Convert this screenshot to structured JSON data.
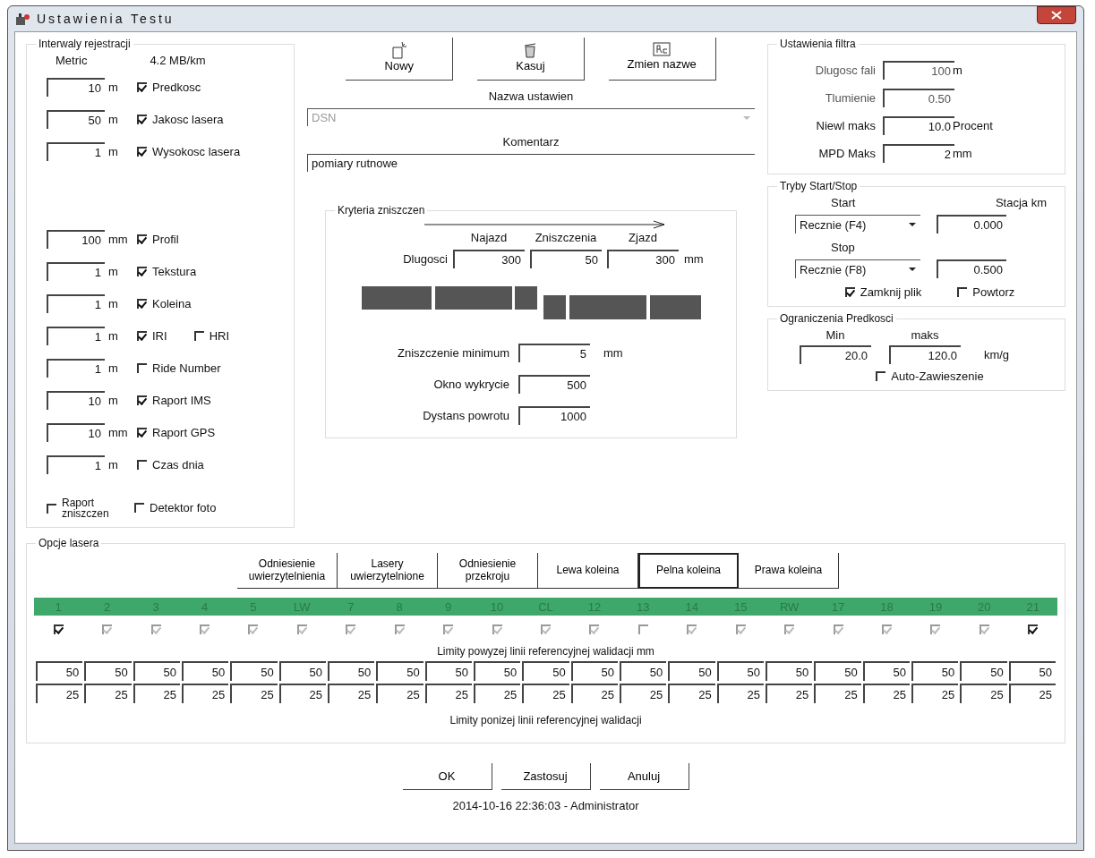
{
  "window": {
    "title": "Ustawienia Testu"
  },
  "intervals": {
    "title": "Interwaly rejestracji",
    "unit_header": "Metric",
    "rate": "4.2 MB/km",
    "groups": [
      {
        "rows": [
          {
            "kind": "field",
            "value": "10",
            "unit": "m",
            "label": "Predkosc",
            "checked": true
          },
          {
            "kind": "field",
            "value": "50",
            "unit": "m",
            "label": "Jakosc lasera",
            "checked": true
          },
          {
            "kind": "field",
            "value": "1",
            "unit": "m",
            "label": "Wysokosc lasera",
            "checked": true
          }
        ]
      },
      {
        "rows": [
          {
            "kind": "field",
            "value": "100",
            "unit": "mm",
            "label": "Profil",
            "checked": true
          },
          {
            "kind": "field",
            "value": "1",
            "unit": "m",
            "label": "Tekstura",
            "checked": true
          },
          {
            "kind": "field",
            "value": "1",
            "unit": "m",
            "label": "Koleina",
            "checked": true
          },
          {
            "kind": "field",
            "value": "1",
            "unit": "m",
            "label": "IRI",
            "checked": true,
            "extra": {
              "label": "HRI",
              "checked": false
            }
          },
          {
            "kind": "field",
            "value": "1",
            "unit": "m",
            "label": "Ride Number",
            "checked": false
          },
          {
            "kind": "field",
            "value": "10",
            "unit": "m",
            "label": "Raport IMS",
            "checked": true
          },
          {
            "kind": "field",
            "value": "10",
            "unit": "mm",
            "label": "Raport GPS",
            "checked": true
          },
          {
            "kind": "field",
            "value": "1",
            "unit": "m",
            "label": "Czas dnia",
            "checked": false
          },
          {
            "kind": "pair",
            "label": "Raport zniszczen",
            "checked": false,
            "extra": {
              "label": "Detektor foto",
              "checked": false
            }
          }
        ]
      }
    ]
  },
  "toolbar": [
    {
      "label": "Nowy",
      "kind": "new"
    },
    {
      "label": "Kasuj",
      "kind": "delete"
    },
    {
      "label": "Zmien nazwe",
      "kind": "rename"
    }
  ],
  "setting_name": {
    "label": "Nazwa ustawien",
    "value": "DSN"
  },
  "comment": {
    "label": "Komentarz",
    "value": "pomiary rutnowe"
  },
  "criteria": {
    "title": "Kryteria zniszczen",
    "headers": [
      "Najazd",
      "Zniszczenia",
      "Zjazd"
    ],
    "length_label": "Dlugosci",
    "lengths": [
      "300",
      "50",
      "300"
    ],
    "length_unit": "mm",
    "fields": [
      {
        "label": "Zniszczenie minimum",
        "value": "5",
        "unit": "mm"
      },
      {
        "label": "Okno wykrycie",
        "value": "500"
      },
      {
        "label": "Dystans powrotu",
        "value": "1000"
      }
    ]
  },
  "filter": {
    "title": "Ustawienia filtra",
    "fields": [
      {
        "label": "Dlugosc fali",
        "value": "100",
        "unit": "m",
        "disabled": true
      },
      {
        "label": "Tlumienie",
        "value": "0.50",
        "disabled": true
      },
      {
        "label": "Niewl maks",
        "value": "10.0",
        "unit": "Procent",
        "disabled": false
      },
      {
        "label": "MPD Maks",
        "value": "2",
        "unit": "mm",
        "disabled": false
      }
    ]
  },
  "start_stop": {
    "title": "Tryby Start/Stop",
    "station_label": "Stacja  km",
    "modes": [
      {
        "label": "Start",
        "value": "Recznie (F4)",
        "station": "0.000"
      },
      {
        "label": "Stop",
        "value": "Recznie (F8)",
        "station": "0.500"
      }
    ],
    "options": [
      {
        "label": "Zamknij plik",
        "checked": true
      },
      {
        "label": "Powtorz",
        "checked": false
      }
    ]
  },
  "speed": {
    "title": "Ograniczenia Predkosci",
    "min_label": "Min",
    "max_label": "maks",
    "min": "20.0",
    "max": "120.0",
    "unit": "km/g",
    "auto": {
      "label": "Auto-Zawieszenie",
      "checked": false
    }
  },
  "laser": {
    "title": "Opcje lasera",
    "tabs": [
      {
        "label": "Odniesienie uwierzytelnienia",
        "selected": false
      },
      {
        "label": "Lasery uwierzytelnione",
        "selected": false
      },
      {
        "label": "Odniesienie przekroju",
        "selected": false
      },
      {
        "label": "Lewa koleina",
        "selected": false
      },
      {
        "label": "Pelna koleina",
        "selected": true
      },
      {
        "label": "Prawa koleina",
        "selected": false
      }
    ],
    "groups": [
      {
        "lasers": [
          {
            "label": "1",
            "checked": true,
            "disabled": false
          },
          {
            "label": "2",
            "checked": true,
            "disabled": true
          },
          {
            "label": "3",
            "checked": true,
            "disabled": true
          },
          {
            "label": "4",
            "checked": true,
            "disabled": true
          },
          {
            "label": "5",
            "checked": true,
            "disabled": true
          },
          {
            "label": "LW",
            "checked": true,
            "disabled": true
          },
          {
            "label": "7",
            "checked": true,
            "disabled": true
          },
          {
            "label": "8",
            "checked": true,
            "disabled": true
          },
          {
            "label": "9",
            "checked": true,
            "disabled": true
          },
          {
            "label": "10",
            "checked": true,
            "disabled": true
          }
        ]
      },
      {
        "lasers": [
          {
            "label": "CL",
            "checked": true,
            "disabled": true
          }
        ]
      },
      {
        "lasers": [
          {
            "label": "12",
            "checked": true,
            "disabled": true
          },
          {
            "label": "13",
            "checked": false,
            "disabled": true
          },
          {
            "label": "14",
            "checked": true,
            "disabled": true
          },
          {
            "label": "15",
            "checked": true,
            "disabled": true
          },
          {
            "label": "RW",
            "checked": true,
            "disabled": true
          },
          {
            "label": "17",
            "checked": true,
            "disabled": true
          },
          {
            "label": "18",
            "checked": true,
            "disabled": true
          },
          {
            "label": "19",
            "checked": true,
            "disabled": true
          },
          {
            "label": "20",
            "checked": true,
            "disabled": true
          },
          {
            "label": "21",
            "checked": true,
            "disabled": false
          }
        ]
      }
    ],
    "upper_label": "Limity powyzej linii referencyjnej walidacji  mm",
    "upper": [
      "50",
      "50",
      "50",
      "50",
      "50",
      "50",
      "50",
      "50",
      "50",
      "50",
      "50",
      "50",
      "50",
      "50",
      "50",
      "50",
      "50",
      "50",
      "50",
      "50",
      "50"
    ],
    "lower": [
      "25",
      "25",
      "25",
      "25",
      "25",
      "25",
      "25",
      "25",
      "25",
      "25",
      "25",
      "25",
      "25",
      "25",
      "25",
      "25",
      "25",
      "25",
      "25",
      "25",
      "25"
    ],
    "lower_label": "Limity ponizej linii referencyjnej walidacji"
  },
  "buttons": [
    "OK",
    "Zastosuj",
    "Anuluj"
  ],
  "status": "2014-10-16 22:36:03 - Administrator"
}
